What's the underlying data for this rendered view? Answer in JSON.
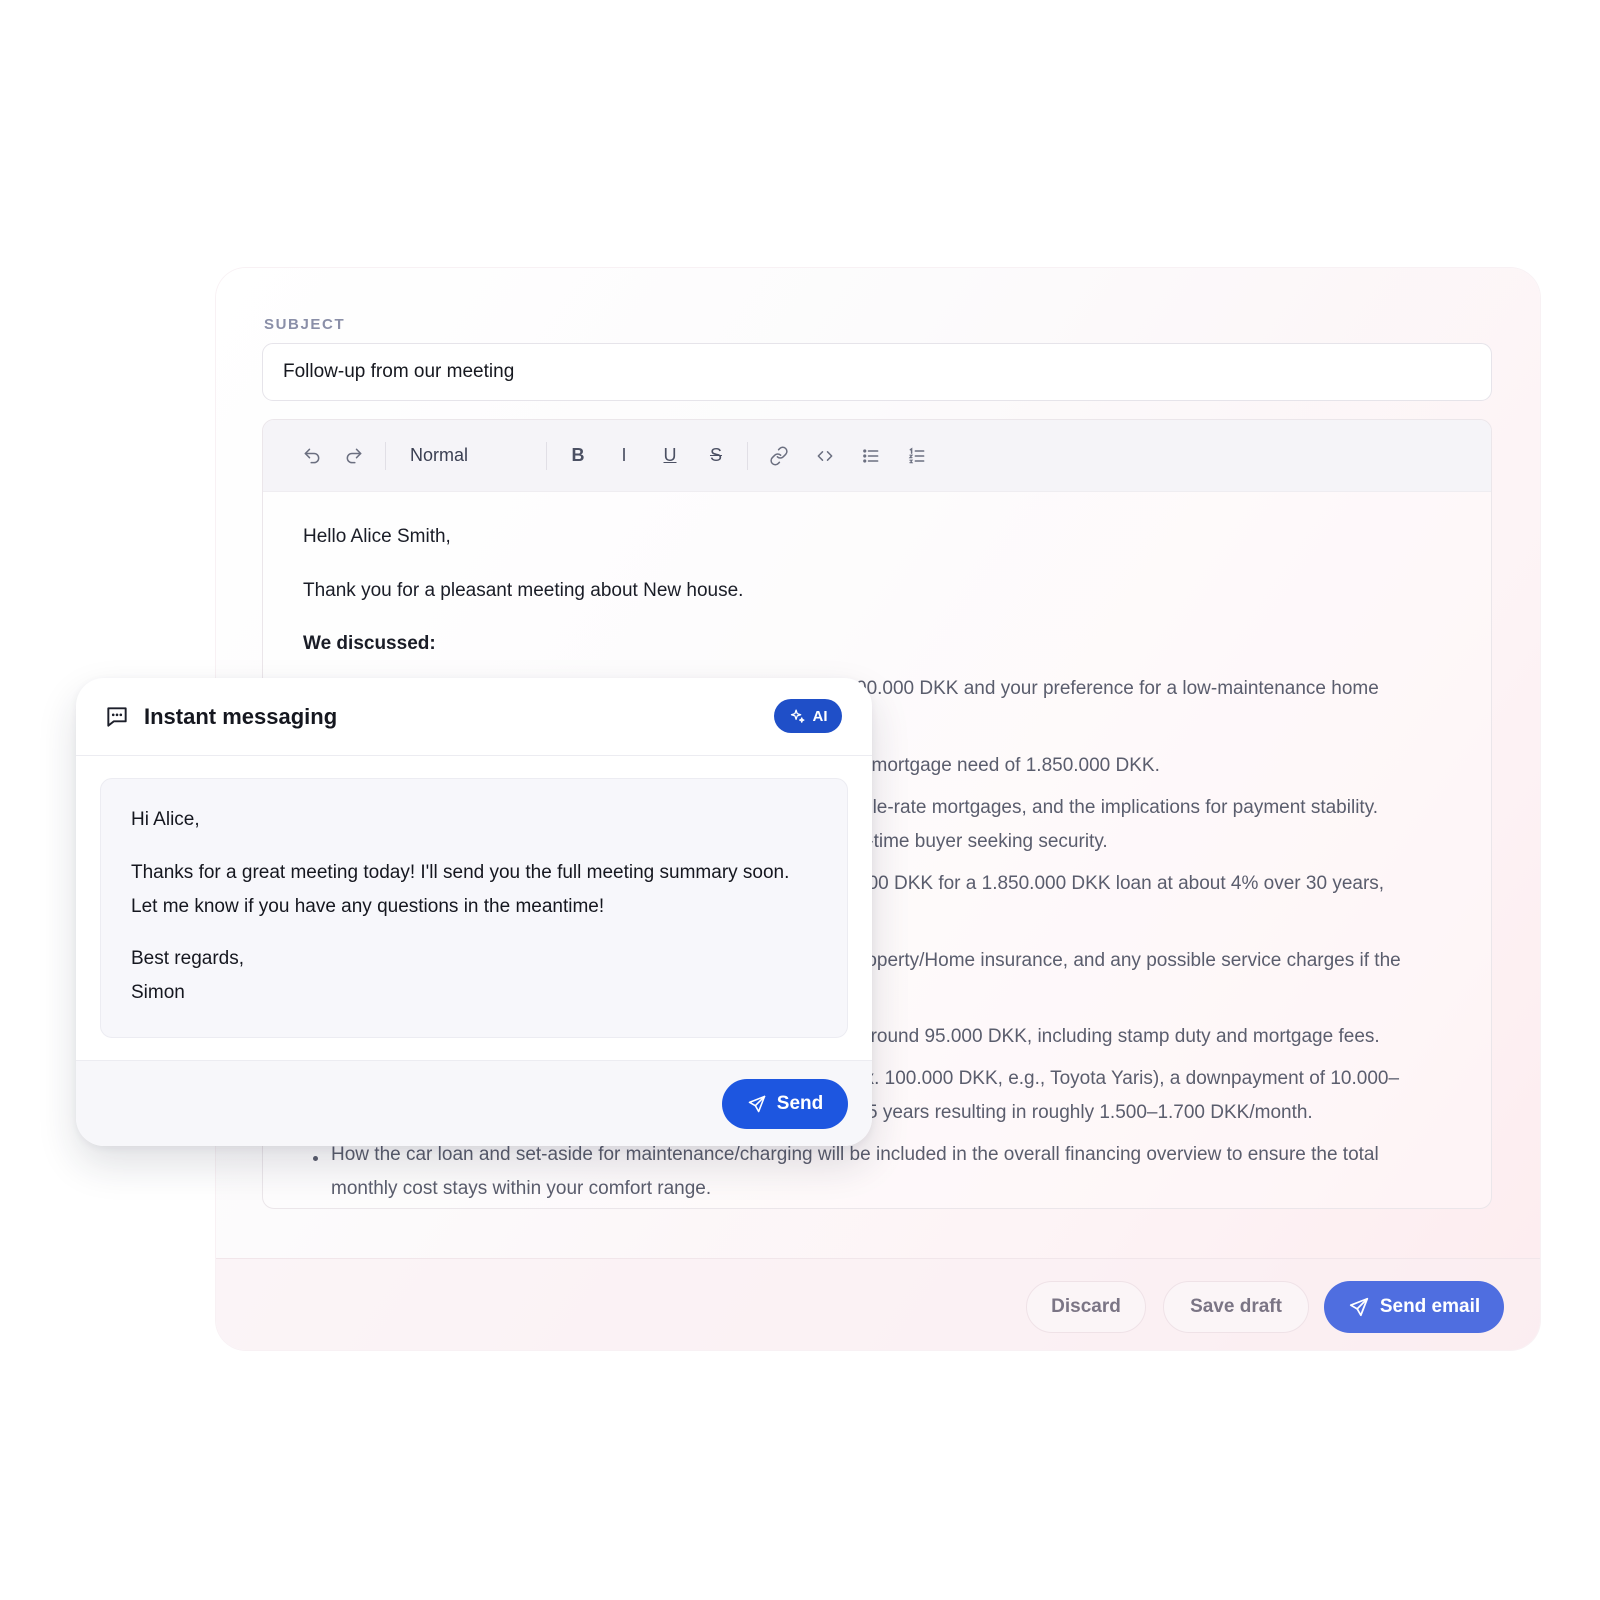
{
  "composer": {
    "subject_label": "SUBJECT",
    "subject_value": "Follow-up from our meeting",
    "toolbar": {
      "undo_icon": "undo-icon",
      "redo_icon": "redo-icon",
      "block_style": "Normal",
      "bold": "B",
      "italic": "I",
      "underline": "U",
      "strikethrough": "S",
      "link_icon": "link-icon",
      "code_icon": "code-icon",
      "bullet_list_icon": "bullet-list-icon",
      "numbered_list_icon": "numbered-list-icon"
    },
    "body": {
      "greeting": "Hello Alice Smith,",
      "intro": "Thank you for a pleasant meeting about New house.",
      "discussed_heading": "We discussed:",
      "visible_fragments": [
        "00.000 DKK and your preference for a low-maintenance home",
        "l mortgage need of 1.850.000 DKK.",
        "ble-rate mortgages, and the implications for payment stability.",
        "t-time buyer seeking security.",
        "500 DKK for a 1.850.000 DKK loan at about 4% over 30 years,",
        "roperty/Home insurance, and any possible service charges if the",
        "around 95.000 DKK, including stamp duty and mortgage fees.",
        "ox. 100.000 DKK, e.g., Toyota Yaris), a downpayment of 10.000–",
        "5 years resulting in roughly 1.500–1.700 DKK/month."
      ],
      "last_bullet_line1": "How the car loan and set-aside for maintenance/charging will be included in the overall financing overview to ensure the total",
      "last_bullet_line2": "monthly cost stays within your comfort range."
    },
    "footer": {
      "discard_label": "Discard",
      "save_draft_label": "Save draft",
      "send_email_label": "Send email"
    }
  },
  "instant_messaging": {
    "title": "Instant messaging",
    "ai_badge": "AI",
    "message": {
      "greeting": "Hi Alice,",
      "line1": "Thanks for a great meeting today! I'll send you the full meeting summary soon.",
      "line2": "Let me know if you have any questions in the meantime!",
      "closing": "Best regards,",
      "signature": "Simon"
    },
    "send_label": "Send"
  },
  "colors": {
    "primary": "#4f6ee0",
    "im_send": "#1d56e0",
    "ai_badge": "#1f4fc8"
  }
}
